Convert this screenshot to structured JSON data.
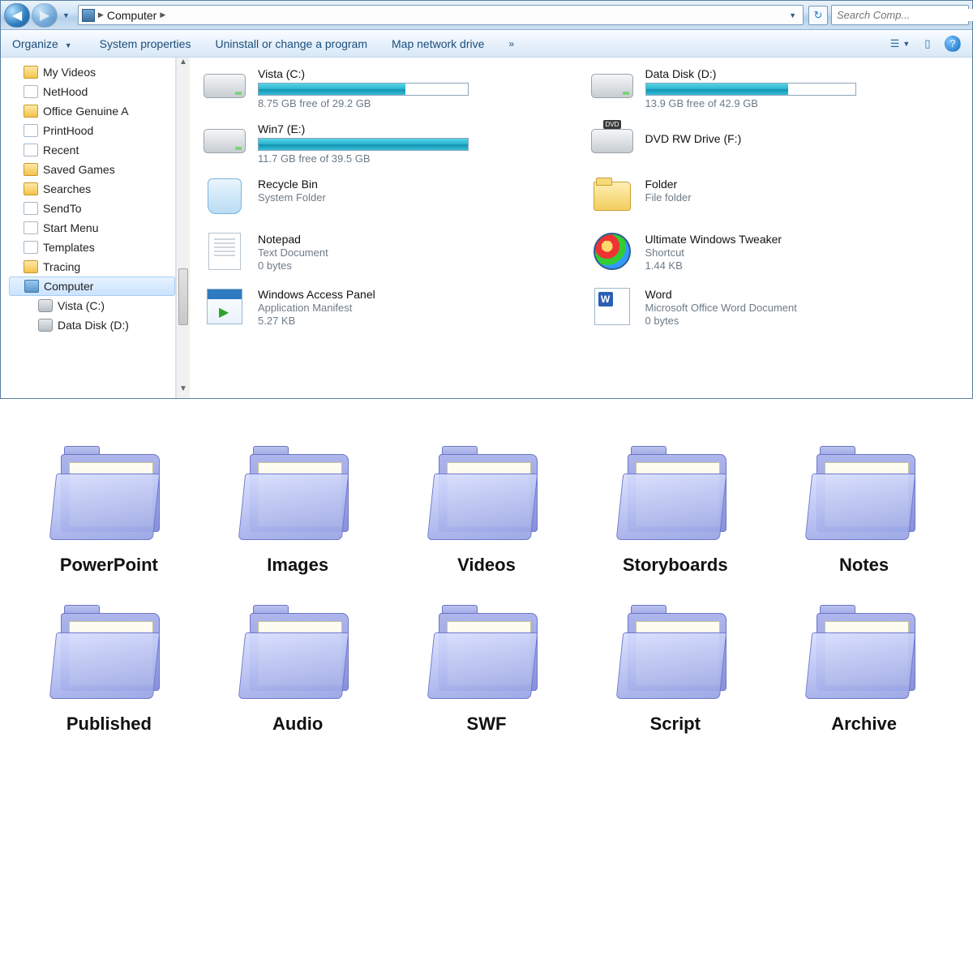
{
  "nav": {
    "crumb": "Computer",
    "search_placeholder": "Search Comp..."
  },
  "toolbar": {
    "organize": "Organize",
    "sysprops": "System properties",
    "uninstall": "Uninstall or change a program",
    "mapdrive": "Map network drive"
  },
  "sidebar": {
    "items": [
      {
        "label": "My Videos",
        "icon": "folder"
      },
      {
        "label": "NetHood",
        "icon": "file"
      },
      {
        "label": "Office Genuine A",
        "icon": "folder"
      },
      {
        "label": "PrintHood",
        "icon": "file"
      },
      {
        "label": "Recent",
        "icon": "file"
      },
      {
        "label": "Saved Games",
        "icon": "folder"
      },
      {
        "label": "Searches",
        "icon": "folder"
      },
      {
        "label": "SendTo",
        "icon": "file"
      },
      {
        "label": "Start Menu",
        "icon": "file"
      },
      {
        "label": "Templates",
        "icon": "file"
      },
      {
        "label": "Tracing",
        "icon": "folder"
      }
    ],
    "computer": "Computer",
    "drives": [
      {
        "label": "Vista (C:)"
      },
      {
        "label": "Data Disk (D:)"
      }
    ]
  },
  "drives": [
    {
      "name": "Vista (C:)",
      "free": "8.75 GB free of 29.2 GB",
      "pct": 70
    },
    {
      "name": "Data Disk (D:)",
      "free": "13.9 GB free of 42.9 GB",
      "pct": 68
    },
    {
      "name": "Win7 (E:)",
      "free": "11.7 GB free of 39.5 GB",
      "pct": 100
    },
    {
      "name": "DVD RW Drive (F:)"
    }
  ],
  "items": [
    {
      "name": "Recycle Bin",
      "sub": "System Folder"
    },
    {
      "name": "Folder",
      "sub": "File folder"
    },
    {
      "name": "Notepad",
      "sub": "Text Document",
      "sub2": "0 bytes"
    },
    {
      "name": "Ultimate Windows  Tweaker",
      "sub": "Shortcut",
      "sub2": "1.44 KB"
    },
    {
      "name": "Windows Access Panel",
      "sub": "Application Manifest",
      "sub2": "5.27 KB"
    },
    {
      "name": "Word",
      "sub": "Microsoft Office Word Document",
      "sub2": "0 bytes"
    }
  ],
  "folders": [
    "PowerPoint",
    "Images",
    "Videos",
    "Storyboards",
    "Notes",
    "Published",
    "Audio",
    "SWF",
    "Script",
    "Archive"
  ]
}
